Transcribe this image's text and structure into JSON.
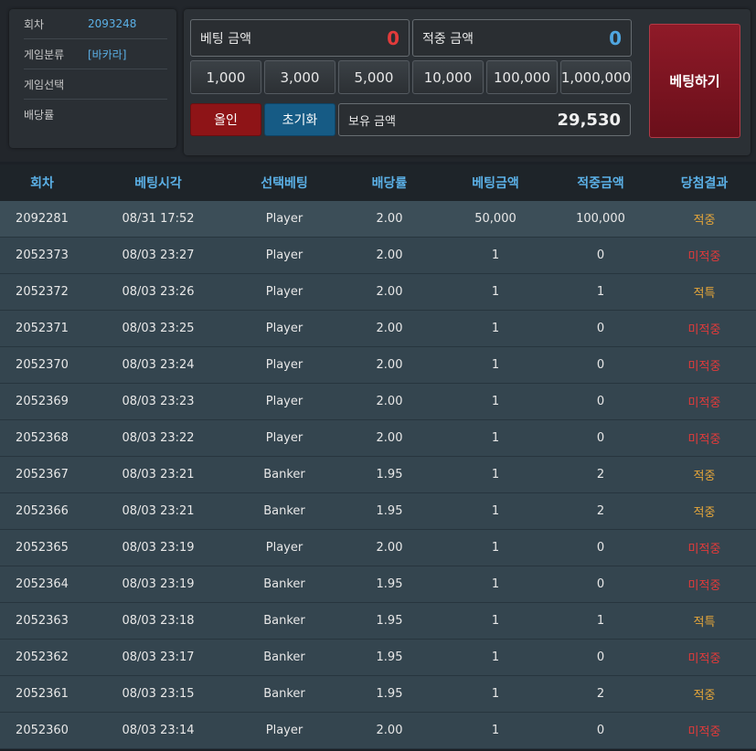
{
  "info": {
    "rows": [
      {
        "label": "회차",
        "value": "2093248"
      },
      {
        "label": "게임분류",
        "value": "[바카라]"
      },
      {
        "label": "게임선택",
        "value": ""
      },
      {
        "label": "배당률",
        "value": ""
      }
    ]
  },
  "bet": {
    "bet_amount_label": "베팅 금액",
    "bet_amount_value": "0",
    "win_amount_label": "적중 금액",
    "win_amount_value": "0",
    "chips": [
      "1,000",
      "3,000",
      "5,000",
      "10,000",
      "100,000",
      "1,000,000"
    ],
    "allin_label": "올인",
    "reset_label": "초기화",
    "balance_label": "보유 금액",
    "balance_value": "29,530",
    "bet_button_label": "베팅하기"
  },
  "colors": {
    "accent_blue": "#5bb0e6",
    "win_orange": "#e6a63a",
    "lose_red": "#e43a3a",
    "allin_red": "#8e1417",
    "reset_blue": "#165b85"
  },
  "table": {
    "headers": [
      "회차",
      "베팅시각",
      "선택베팅",
      "배당률",
      "베팅금액",
      "적중금액",
      "당첨결과"
    ],
    "rows": [
      [
        "2092281",
        "08/31 17:52",
        "Player",
        "2.00",
        "50,000",
        "100,000",
        "적중"
      ],
      [
        "2052373",
        "08/03 23:27",
        "Player",
        "2.00",
        "1",
        "0",
        "미적중"
      ],
      [
        "2052372",
        "08/03 23:26",
        "Player",
        "2.00",
        "1",
        "1",
        "적특"
      ],
      [
        "2052371",
        "08/03 23:25",
        "Player",
        "2.00",
        "1",
        "0",
        "미적중"
      ],
      [
        "2052370",
        "08/03 23:24",
        "Player",
        "2.00",
        "1",
        "0",
        "미적중"
      ],
      [
        "2052369",
        "08/03 23:23",
        "Player",
        "2.00",
        "1",
        "0",
        "미적중"
      ],
      [
        "2052368",
        "08/03 23:22",
        "Player",
        "2.00",
        "1",
        "0",
        "미적중"
      ],
      [
        "2052367",
        "08/03 23:21",
        "Banker",
        "1.95",
        "1",
        "2",
        "적중"
      ],
      [
        "2052366",
        "08/03 23:21",
        "Banker",
        "1.95",
        "1",
        "2",
        "적중"
      ],
      [
        "2052365",
        "08/03 23:19",
        "Player",
        "2.00",
        "1",
        "0",
        "미적중"
      ],
      [
        "2052364",
        "08/03 23:19",
        "Banker",
        "1.95",
        "1",
        "0",
        "미적중"
      ],
      [
        "2052363",
        "08/03 23:18",
        "Banker",
        "1.95",
        "1",
        "1",
        "적특"
      ],
      [
        "2052362",
        "08/03 23:17",
        "Banker",
        "1.95",
        "1",
        "0",
        "미적중"
      ],
      [
        "2052361",
        "08/03 23:15",
        "Banker",
        "1.95",
        "1",
        "2",
        "적중"
      ],
      [
        "2052360",
        "08/03 23:14",
        "Player",
        "2.00",
        "1",
        "0",
        "미적중"
      ]
    ]
  }
}
